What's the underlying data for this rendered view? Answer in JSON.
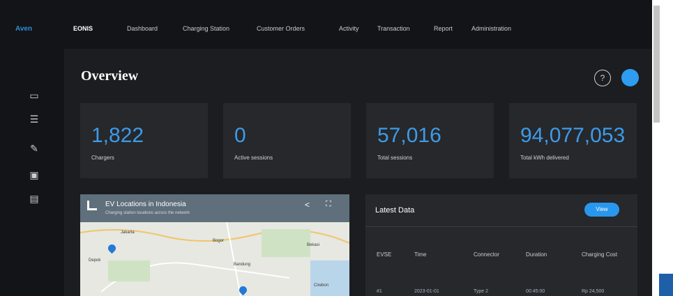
{
  "nav": {
    "brand": "Aven",
    "items": [
      "EONIS",
      "Dashboard",
      "Charging Station",
      "Customer Orders",
      "Activity",
      "Transaction",
      "Report",
      "Administration"
    ]
  },
  "sidebar": {
    "icons": [
      "dashboard-icon",
      "document-icon",
      "tools-icon",
      "monitor-icon",
      "display-icon"
    ]
  },
  "main": {
    "title": "Overview",
    "cards": [
      {
        "value": "1,822",
        "label": "Chargers"
      },
      {
        "value": "0",
        "label": "Active sessions"
      },
      {
        "value": "57,016",
        "label": "Total sessions"
      },
      {
        "value": "94,077,053",
        "label": "Total kWh delivered"
      }
    ],
    "map": {
      "title": "EV Locations in Indonesia",
      "subtitle": "Charging station locations across the network",
      "labels": [
        "Jakarta",
        "Bekasi",
        "Bogor",
        "Depok",
        "Bandung",
        "Cirebon"
      ]
    },
    "latest": {
      "title": "Latest Data",
      "badge": "View",
      "columns": [
        "EVSE",
        "Time",
        "Connector",
        "Duration",
        "Charging Cost"
      ],
      "row": [
        "#1",
        "2023-01-01",
        "Type 2",
        "00:45:00",
        "Rp 24,500"
      ]
    }
  }
}
